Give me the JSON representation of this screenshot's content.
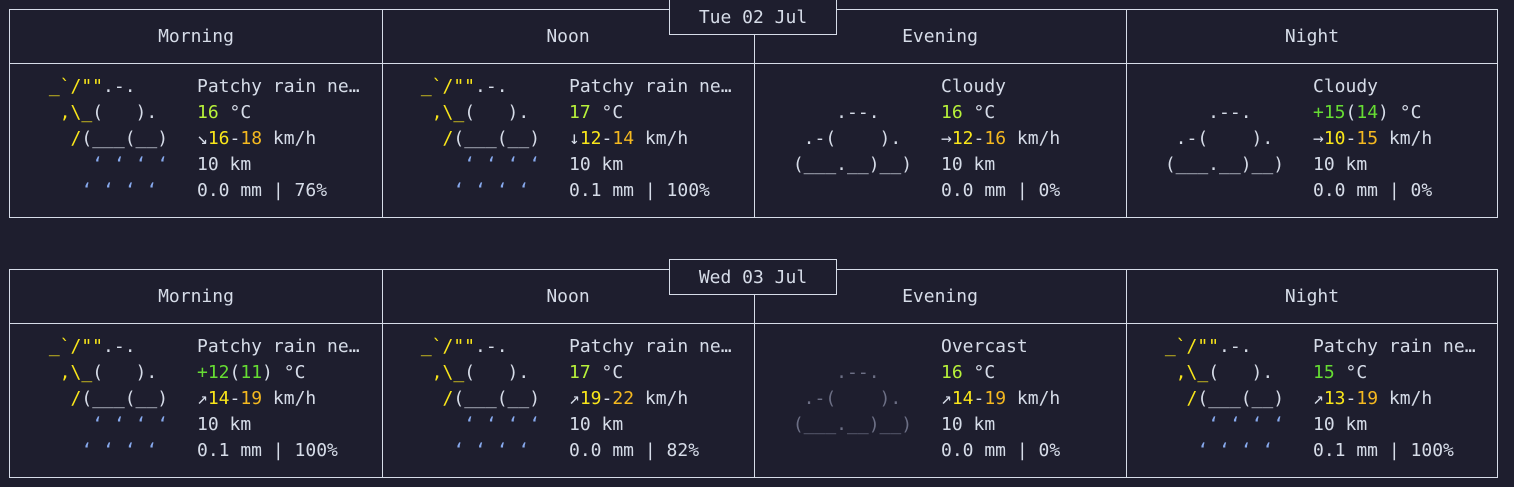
{
  "days": [
    {
      "date": "Tue 02 Jul",
      "periods": [
        {
          "name": "Morning",
          "cond": "Patchy rain ne…",
          "temp": "16",
          "tempExtra": "",
          "tempWhole": "",
          "arrow": "↘",
          "wmin": "16",
          "wmax": "18",
          "vis": "10 km",
          "precip": "0.0 mm | 76%",
          "icon": "rain"
        },
        {
          "name": "Noon",
          "cond": "Patchy rain ne…",
          "temp": "17",
          "tempExtra": "",
          "tempWhole": "",
          "arrow": "↓",
          "wmin": "12",
          "wmax": "14",
          "vis": "10 km",
          "precip": "0.1 mm | 100%",
          "icon": "rain"
        },
        {
          "name": "Evening",
          "cond": "Cloudy",
          "temp": "16",
          "tempExtra": "",
          "tempWhole": "",
          "arrow": "→",
          "wmin": "12",
          "wmax": "16",
          "vis": "10 km",
          "precip": "0.0 mm | 0%",
          "icon": "cloud"
        },
        {
          "name": "Night",
          "cond": "Cloudy",
          "temp": "+15",
          "tempExtra": "14",
          "tempWhole": "",
          "arrow": "→",
          "wmin": "10",
          "wmax": "15",
          "vis": "10 km",
          "precip": "0.0 mm | 0%",
          "icon": "cloud"
        }
      ]
    },
    {
      "date": "Wed 03 Jul",
      "periods": [
        {
          "name": "Morning",
          "cond": "Patchy rain ne…",
          "temp": "+12",
          "tempExtra": "11",
          "tempWhole": "",
          "arrow": "↗",
          "wmin": "14",
          "wmax": "19",
          "vis": "10 km",
          "precip": "0.1 mm | 100%",
          "icon": "rain"
        },
        {
          "name": "Noon",
          "cond": "Patchy rain ne…",
          "temp": "17",
          "tempExtra": "",
          "tempWhole": "",
          "arrow": "↗",
          "wmin": "19",
          "wmax": "22",
          "vis": "10 km",
          "precip": "0.0 mm | 82%",
          "icon": "rain"
        },
        {
          "name": "Evening",
          "cond": "Overcast",
          "temp": "16",
          "tempExtra": "",
          "tempWhole": "",
          "arrow": "↗",
          "wmin": "14",
          "wmax": "19",
          "vis": "10 km",
          "precip": "0.0 mm | 0%",
          "icon": "overcast"
        },
        {
          "name": "Night",
          "cond": "Patchy rain ne…",
          "temp": "15",
          "tempExtra": "",
          "tempWhole": "",
          "arrow": "↗",
          "wmin": "13",
          "wmax": "19",
          "vis": "10 km",
          "precip": "0.1 mm | 100%",
          "icon": "rain"
        }
      ]
    }
  ],
  "unit_temp": "°C",
  "unit_wind": "km/h",
  "colors": {
    "sun": "#f9e61a",
    "rain": "#88aaee",
    "cloud": "#d6dce8",
    "overcast": "#6c6f85",
    "temp_green": "#b8f23a",
    "temp_lime": "#66dd33",
    "wind_orange": "#f5b920"
  }
}
